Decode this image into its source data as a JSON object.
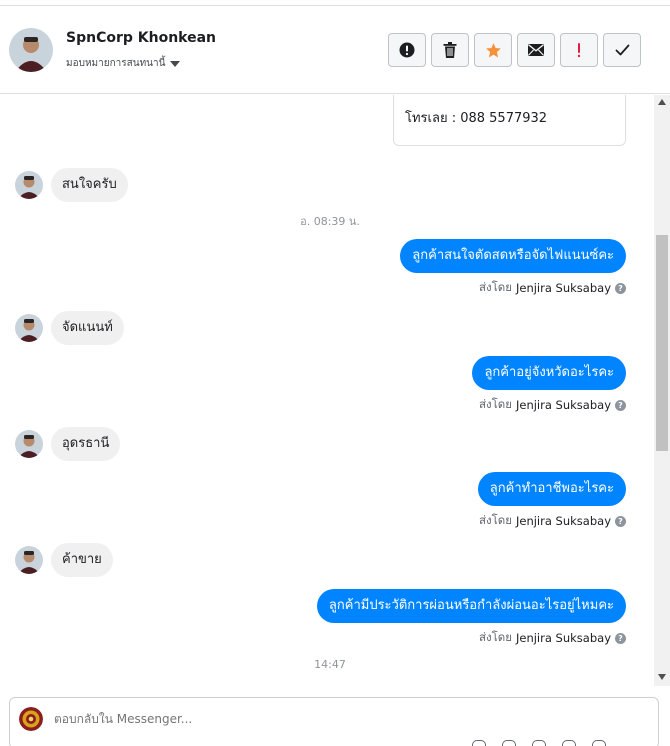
{
  "header": {
    "contact_name": "SpnCorp Khonkean",
    "assign_label": "มอบหมายการสนทนานี้",
    "actions": [
      {
        "name": "spam-button",
        "icon": "exclamation-circle-icon"
      },
      {
        "name": "delete-button",
        "icon": "trash-icon"
      },
      {
        "name": "star-button",
        "icon": "star-icon"
      },
      {
        "name": "mark-unread-button",
        "icon": "envelope-icon"
      },
      {
        "name": "follow-up-button",
        "icon": "exclamation-icon"
      },
      {
        "name": "mark-done-button",
        "icon": "checkmark-icon"
      }
    ]
  },
  "thread": {
    "card_remnant_text": "โทรเลย : 088 5577932",
    "incoming": [
      "สนใจครับ",
      "จัดแนนท์",
      "อุดรธานี",
      "ค้าขาย"
    ],
    "timestamps": [
      "อ. 08:39 น.",
      "14:47"
    ],
    "outgoing": [
      "ลูกค้าสนใจตัดสดหรือจัดไฟแนนซ์คะ",
      "ลูกค้าอยู่จังหวัดอะไรคะ",
      "ลูกค้าทำอาชีพอะไรคะ",
      "ลูกค้ามีประวัติการผ่อนหรือกำลังผ่อนอะไรอยู่ไหมคะ"
    ],
    "sent_by_prefix": "ส่งโดย",
    "agent_name": "Jenjira Suksabay"
  },
  "composer": {
    "placeholder": "ตอบกลับใน Messenger..."
  },
  "colors": {
    "outgoing_bubble": "#0084ff",
    "incoming_bubble": "#f1f0f0",
    "star": "#f7923b",
    "flag": "#e41e3f"
  }
}
